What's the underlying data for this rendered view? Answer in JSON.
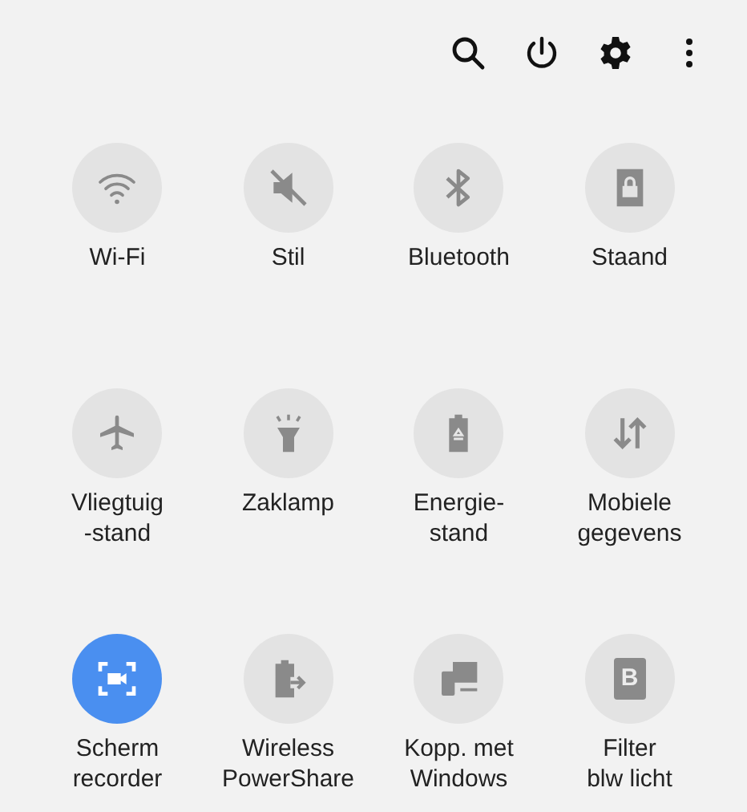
{
  "toolbar": [
    {
      "kind": "search"
    },
    {
      "kind": "power"
    },
    {
      "kind": "settings"
    },
    {
      "kind": "more"
    }
  ],
  "tiles": [
    {
      "label": "Wi-Fi",
      "kind": "wifi",
      "on": false
    },
    {
      "label": "Stil",
      "kind": "mute",
      "on": false
    },
    {
      "label": "Bluetooth",
      "kind": "bluetooth",
      "on": false
    },
    {
      "label": "Staand",
      "kind": "lock",
      "on": false
    },
    {
      "label": "Vliegtuig\n-stand",
      "kind": "airplane",
      "on": false
    },
    {
      "label": "Zaklamp",
      "kind": "flashlight",
      "on": false
    },
    {
      "label": "Energie-\nstand",
      "kind": "battery",
      "on": false
    },
    {
      "label": "Mobiele\ngegevens",
      "kind": "data",
      "on": false
    },
    {
      "label": "Scherm\nrecorder",
      "kind": "recorder",
      "on": true
    },
    {
      "label": "Wireless\nPowerShare",
      "kind": "powershare",
      "on": false
    },
    {
      "label": "Kopp. met\nWindows",
      "kind": "windows",
      "on": false
    },
    {
      "label": "Filter\nblw licht",
      "kind": "filter",
      "on": false,
      "glyph": "B"
    }
  ]
}
